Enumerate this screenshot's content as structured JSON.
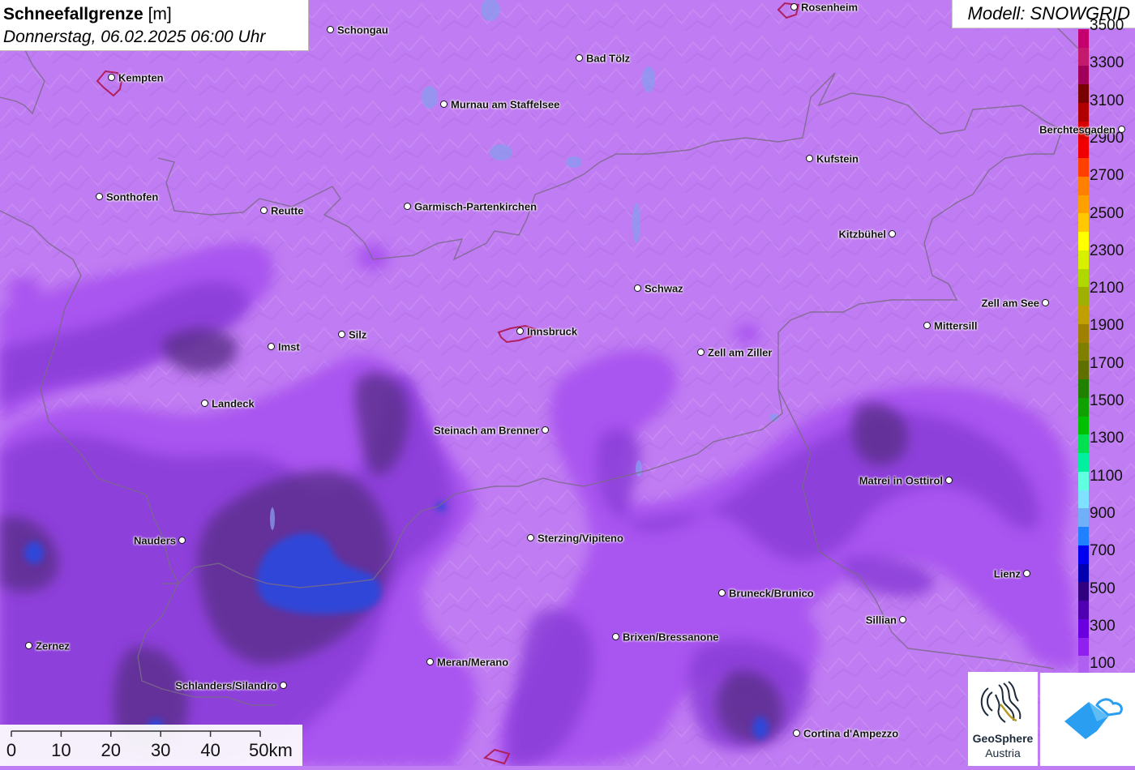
{
  "header": {
    "title_bold": "Schneefallgrenze",
    "title_unit": "[m]",
    "date": "Donnerstag, 06.02.2025 06:00 Uhr"
  },
  "model": {
    "label": "Modell: SNOWGRID"
  },
  "legend": {
    "labels": [
      "3500",
      "3300",
      "3100",
      "2900",
      "2700",
      "2500",
      "2300",
      "2100",
      "1900",
      "1700",
      "1500",
      "1300",
      "1100",
      "900",
      "700",
      "500",
      "300",
      "100"
    ],
    "colors": [
      "#c4006e",
      "#c41a6e",
      "#a0005a",
      "#7a0000",
      "#b00000",
      "#d80000",
      "#f00000",
      "#ff4000",
      "#ff8000",
      "#ffa000",
      "#ffc800",
      "#ffff00",
      "#d8f000",
      "#b0d800",
      "#a0b000",
      "#c0a000",
      "#a08000",
      "#808000",
      "#607000",
      "#208000",
      "#10a000",
      "#00c000",
      "#00e050",
      "#00f0a0",
      "#60ffe0",
      "#80e0ff",
      "#70b0f8",
      "#2080ff",
      "#0000f0",
      "#0000b0",
      "#300080",
      "#5000b0",
      "#6a00e0",
      "#9020f0",
      "#b060f0"
    ]
  },
  "cities": [
    {
      "name": "Rosenheim",
      "side": "right"
    },
    {
      "name": "Schongau",
      "side": "right"
    },
    {
      "name": "Kempten",
      "side": "right"
    },
    {
      "name": "Bad Tölz",
      "side": "right"
    },
    {
      "name": "Murnau am Staffelsee",
      "side": "right"
    },
    {
      "name": "Berchtesgaden",
      "side": "left"
    },
    {
      "name": "Kufstein",
      "side": "right"
    },
    {
      "name": "Sonthofen",
      "side": "right"
    },
    {
      "name": "Reutte",
      "side": "right"
    },
    {
      "name": "Garmisch-Partenkirchen",
      "side": "right"
    },
    {
      "name": "Kitzbühel",
      "side": "left"
    },
    {
      "name": "Schwaz",
      "side": "right"
    },
    {
      "name": "Zell am See",
      "side": "left"
    },
    {
      "name": "Mittersill",
      "side": "right"
    },
    {
      "name": "Innsbruck",
      "side": "right"
    },
    {
      "name": "Silz",
      "side": "right"
    },
    {
      "name": "Imst",
      "side": "right"
    },
    {
      "name": "Zell am Ziller",
      "side": "right"
    },
    {
      "name": "Landeck",
      "side": "right"
    },
    {
      "name": "Steinach am Brenner",
      "side": "left"
    },
    {
      "name": "Matrei in Osttirol",
      "side": "left"
    },
    {
      "name": "Nauders",
      "side": "left"
    },
    {
      "name": "Sterzing/Vipiteno",
      "side": "right"
    },
    {
      "name": "Lienz",
      "side": "left"
    },
    {
      "name": "Bruneck/Brunico",
      "side": "right"
    },
    {
      "name": "Sillian",
      "side": "left"
    },
    {
      "name": "Brixen/Bressanone",
      "side": "right"
    },
    {
      "name": "Zernez",
      "side": "right"
    },
    {
      "name": "Meran/Merano",
      "side": "right"
    },
    {
      "name": "Schlanders/Silandro",
      "side": "left"
    },
    {
      "name": "Cortina d'Ampezzo",
      "side": "right"
    }
  ],
  "scale": {
    "ticks": [
      "0",
      "10",
      "20",
      "30",
      "40",
      "50km"
    ]
  },
  "logos": {
    "geosphere_line1": "GeoSphere",
    "geosphere_line2": "Austria"
  }
}
